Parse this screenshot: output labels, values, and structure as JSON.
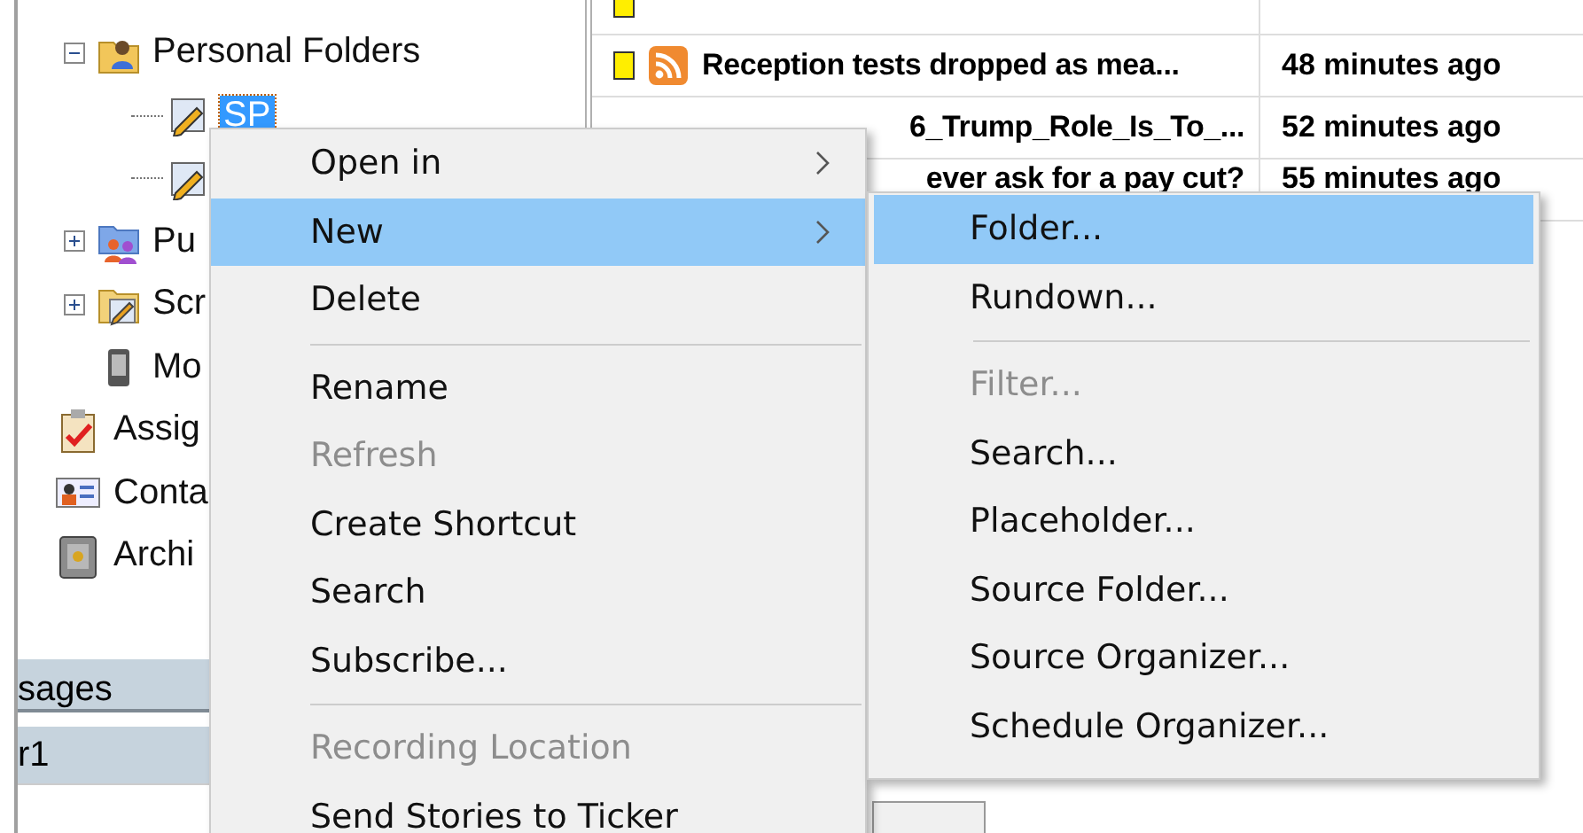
{
  "tree": {
    "items": [
      {
        "label": "Personal Folders",
        "expanded": true,
        "children": [
          {
            "label": "SP",
            "selected": true
          }
        ]
      },
      {
        "label": "Pu",
        "expanded": false
      },
      {
        "label": "Scr",
        "expanded": false
      },
      {
        "label": "Mo"
      }
    ],
    "top_items": [
      {
        "label": "Assig"
      },
      {
        "label": "Conta"
      },
      {
        "label": "Archi"
      }
    ]
  },
  "messages_panel": {
    "header": "sages",
    "rows": [
      {
        "label": "r1",
        "selected": true
      }
    ]
  },
  "table": {
    "rows": [
      {
        "color": "#ffee00",
        "feed": true,
        "title": "Reception tests dropped as mea...",
        "time": "48 minutes ago",
        "bold": true
      },
      {
        "title": "6_Trump_Role_Is_To_...",
        "time": "52 minutes ago",
        "bold": true
      },
      {
        "title": "ever ask for a pay cut?",
        "time": "55 minutes ago",
        "bold": true
      }
    ]
  },
  "context_menu": {
    "items": [
      {
        "kind": "item",
        "label": "Open in",
        "submenu": true,
        "selected": false,
        "disabled": false
      },
      {
        "kind": "item",
        "label": "New",
        "submenu": true,
        "selected": true,
        "disabled": false
      },
      {
        "kind": "item",
        "label": "Delete",
        "submenu": false,
        "selected": false,
        "disabled": false
      },
      {
        "kind": "separator"
      },
      {
        "kind": "item",
        "label": "Rename",
        "submenu": false,
        "selected": false,
        "disabled": false
      },
      {
        "kind": "item",
        "label": "Refresh",
        "submenu": false,
        "selected": false,
        "disabled": true
      },
      {
        "kind": "item",
        "label": "Create Shortcut",
        "submenu": false,
        "selected": false,
        "disabled": false
      },
      {
        "kind": "item",
        "label": "Search",
        "submenu": false,
        "selected": false,
        "disabled": false
      },
      {
        "kind": "item",
        "label": "Subscribe...",
        "submenu": false,
        "selected": false,
        "disabled": false
      },
      {
        "kind": "separator"
      },
      {
        "kind": "item",
        "label": "Recording Location",
        "submenu": false,
        "selected": false,
        "disabled": true
      },
      {
        "kind": "item",
        "label": "Send Stories to Ticker",
        "submenu": false,
        "selected": false,
        "disabled": false
      }
    ]
  },
  "submenu": {
    "items": [
      {
        "kind": "item",
        "label": "Folder...",
        "selected": true,
        "disabled": false
      },
      {
        "kind": "item",
        "label": "Rundown...",
        "selected": false,
        "disabled": false
      },
      {
        "kind": "separator"
      },
      {
        "kind": "item",
        "label": "Filter...",
        "selected": false,
        "disabled": true
      },
      {
        "kind": "item",
        "label": "Search...",
        "selected": false,
        "disabled": false
      },
      {
        "kind": "item",
        "label": "Placeholder...",
        "selected": false,
        "disabled": false
      },
      {
        "kind": "item",
        "label": "Source Folder...",
        "selected": false,
        "disabled": false
      },
      {
        "kind": "item",
        "label": "Source Organizer...",
        "selected": false,
        "disabled": false
      },
      {
        "kind": "item",
        "label": "Schedule Organizer...",
        "selected": false,
        "disabled": false
      }
    ]
  }
}
